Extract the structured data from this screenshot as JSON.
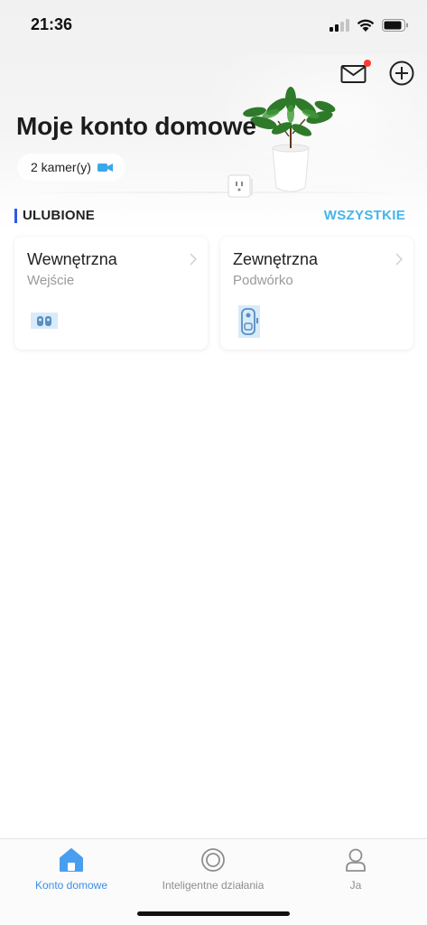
{
  "status_bar": {
    "time": "21:36"
  },
  "header": {
    "title": "Moje konto domowe",
    "camera_count": "2 kamer(y)",
    "icons": [
      "mail-icon",
      "add-circle-icon",
      "video-camera-icon"
    ],
    "notification_dot_color": "#ff3b30"
  },
  "favorites": {
    "title": "ULUBIONE",
    "see_all": "WSZYSTKIE",
    "accent": "#2f57e8",
    "link_color": "#46b4ea",
    "cards": [
      {
        "name": "Wewnętrzna",
        "room": "Wejście",
        "device_icon": "indoor-camera-icon"
      },
      {
        "name": "Zewnętrzna",
        "room": "Podwórko",
        "device_icon": "doorbell-camera-icon"
      }
    ]
  },
  "tab_bar": {
    "active_color": "#3a8ee6",
    "tabs": [
      {
        "label": "Konto domowe",
        "icon": "home-icon",
        "active": true
      },
      {
        "label": "Inteligentne działania",
        "icon": "smart-action-icon",
        "active": false
      },
      {
        "label": "Ja",
        "icon": "user-icon",
        "active": false
      }
    ]
  }
}
